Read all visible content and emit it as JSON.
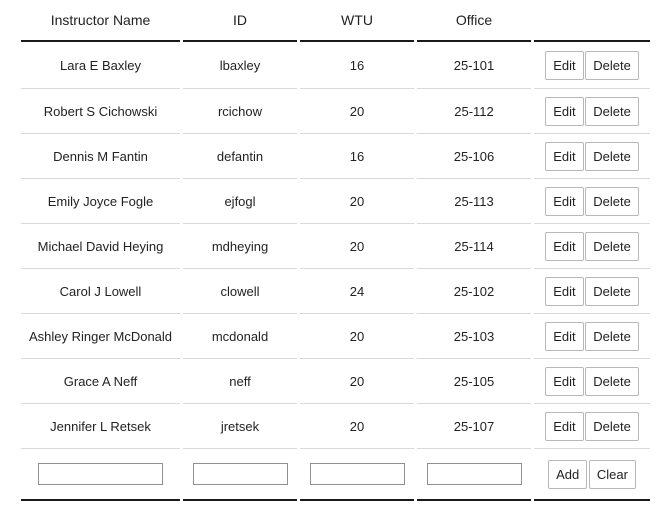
{
  "table": {
    "headers": [
      "Instructor Name",
      "ID",
      "WTU",
      "Office",
      ""
    ],
    "rows": [
      {
        "name": "Lara E Baxley",
        "id": "lbaxley",
        "wtu": "16",
        "office": "25-101"
      },
      {
        "name": "Robert S Cichowski",
        "id": "rcichow",
        "wtu": "20",
        "office": "25-112"
      },
      {
        "name": "Dennis M Fantin",
        "id": "defantin",
        "wtu": "16",
        "office": "25-106"
      },
      {
        "name": "Emily Joyce Fogle",
        "id": "ejfogl",
        "wtu": "20",
        "office": "25-113"
      },
      {
        "name": "Michael David Heying",
        "id": "mdheying",
        "wtu": "20",
        "office": "25-114"
      },
      {
        "name": "Carol J Lowell",
        "id": "clowell",
        "wtu": "24",
        "office": "25-102"
      },
      {
        "name": "Ashley Ringer McDonald",
        "id": "mcdonald",
        "wtu": "20",
        "office": "25-103"
      },
      {
        "name": "Grace A Neff",
        "id": "neff",
        "wtu": "20",
        "office": "25-105"
      },
      {
        "name": "Jennifer L Retsek",
        "id": "jretsek",
        "wtu": "20",
        "office": "25-107"
      }
    ],
    "edit_label": "Edit",
    "delete_label": "Delete"
  },
  "add_form": {
    "name_value": "",
    "id_value": "",
    "wtu_value": "",
    "office_value": "",
    "add_label": "Add",
    "clear_label": "Clear"
  }
}
